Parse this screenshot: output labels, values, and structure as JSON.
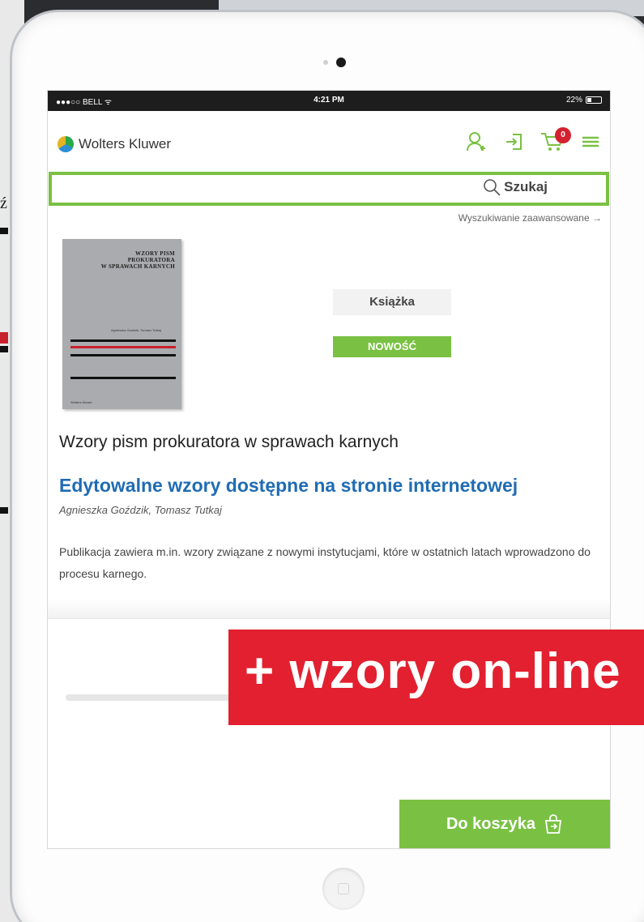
{
  "status_bar": {
    "carrier": "●●●○○ BELL ᯤ",
    "time": "4:21 PM",
    "battery": "22%"
  },
  "header": {
    "brand": "Wolters Kluwer",
    "cart_count": "0"
  },
  "search": {
    "button_label": "Szukaj",
    "placeholder": "",
    "advanced_link": "Wyszukiwanie zaawansowane →"
  },
  "book_cover": {
    "title_lines": [
      "WZORY PISM",
      "PROKURATORA",
      "W SPRAWACH KARNYCH"
    ]
  },
  "product": {
    "type_label": "Książka",
    "badge": "NOWOŚĆ",
    "title": "Wzory pism prokuratora w sprawach karnych",
    "subtitle": "Edytowalne wzory dostępne na stronie internetowej",
    "authors": "Agnieszka Goździk, Tomasz Tutkaj",
    "description": "Publikacja zawiera m.in. wzory związane z nowymi instytucjami, które w ostatnich latach wprowadzono do procesu karnego."
  },
  "cart_button": {
    "label": "Do koszyka"
  },
  "overlay": {
    "banner_text": "+ wzory on-line"
  },
  "background": {
    "glyph": "ź"
  },
  "colors": {
    "green": "#7ac143",
    "blue": "#1f6cb3",
    "red": "#e2202f"
  }
}
